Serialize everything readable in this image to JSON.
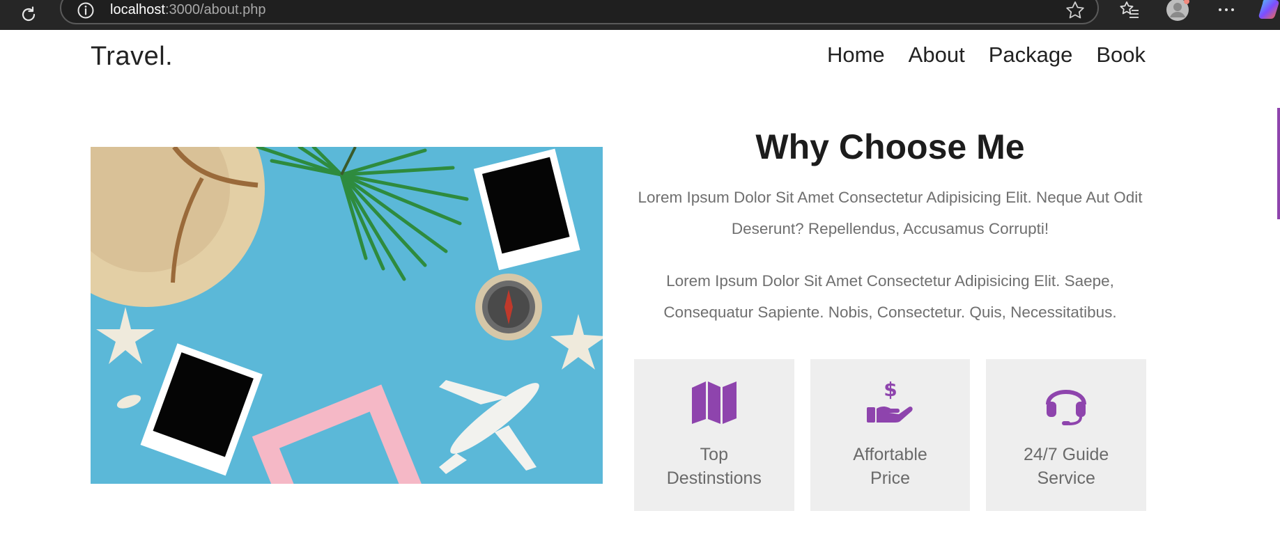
{
  "browser": {
    "url_host": "localhost",
    "url_rest": ":3000/about.php"
  },
  "site": {
    "logo": "Travel.",
    "nav": [
      "Home",
      "About",
      "Package",
      "Book"
    ]
  },
  "about": {
    "heading": "Why Choose Me",
    "paragraphs": [
      "Lorem Ipsum Dolor Sit Amet Consectetur Adipisicing Elit. Neque Aut Odit Deserunt? Repellendus, Accusamus Corrupti!",
      "Lorem Ipsum Dolor Sit Amet Consectetur Adipisicing Elit. Saepe, Consequatur Sapiente. Nobis, Consectetur. Quis, Necessitatibus."
    ],
    "features": [
      {
        "icon": "map-icon",
        "label": "Top Destinstions"
      },
      {
        "icon": "hand-dollar-icon",
        "label": "Affortable Price"
      },
      {
        "icon": "headset-icon",
        "label": "24/7 Guide Service"
      }
    ]
  },
  "colors": {
    "accent": "#8e44ad",
    "chrome_bg": "#262626",
    "card_bg": "#eeeeee",
    "photo_bg": "#5bb8d8"
  }
}
